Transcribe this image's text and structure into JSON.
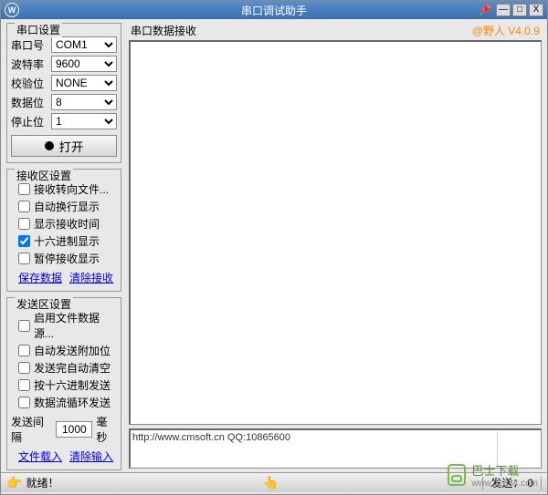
{
  "titlebar": {
    "icon_letter": "W",
    "title": "串口调试助手",
    "min": "—",
    "max": "□",
    "close": "X"
  },
  "serial_settings": {
    "title": "串口设置",
    "port_label": "串口号",
    "port_value": "COM1",
    "baud_label": "波特率",
    "baud_value": "9600",
    "parity_label": "校验位",
    "parity_value": "NONE",
    "databits_label": "数据位",
    "databits_value": "8",
    "stopbits_label": "停止位",
    "stopbits_value": "1",
    "open_label": "打开"
  },
  "receive_settings": {
    "title": "接收区设置",
    "to_file": "接收转向文件...",
    "auto_wrap": "自动换行显示",
    "show_time": "显示接收时间",
    "hex_display": "十六进制显示",
    "pause": "暂停接收显示",
    "save_data": "保存数据",
    "clear_receive": "清除接收"
  },
  "send_settings": {
    "title": "发送区设置",
    "file_source": "启用文件数据源...",
    "auto_append": "自动发送附加位",
    "auto_clear": "发送完自动清空",
    "hex_send": "按十六进制发送",
    "loop_send": "数据流循环发送",
    "interval_label": "发送间隔",
    "interval_value": "1000",
    "interval_unit": "毫秒",
    "load_file": "文件载入",
    "clear_input": "清除输入"
  },
  "receive_area": {
    "title": "串口数据接收",
    "version": "@野人 V4.0.9"
  },
  "send_area": {
    "text": "http://www.cmsoft.cn QQ:10865600"
  },
  "statusbar": {
    "ready": "就绪！",
    "send_label": "发送：",
    "send_count": "0"
  },
  "watermark": {
    "text": "巴士下载",
    "url": "www.11684.com"
  }
}
